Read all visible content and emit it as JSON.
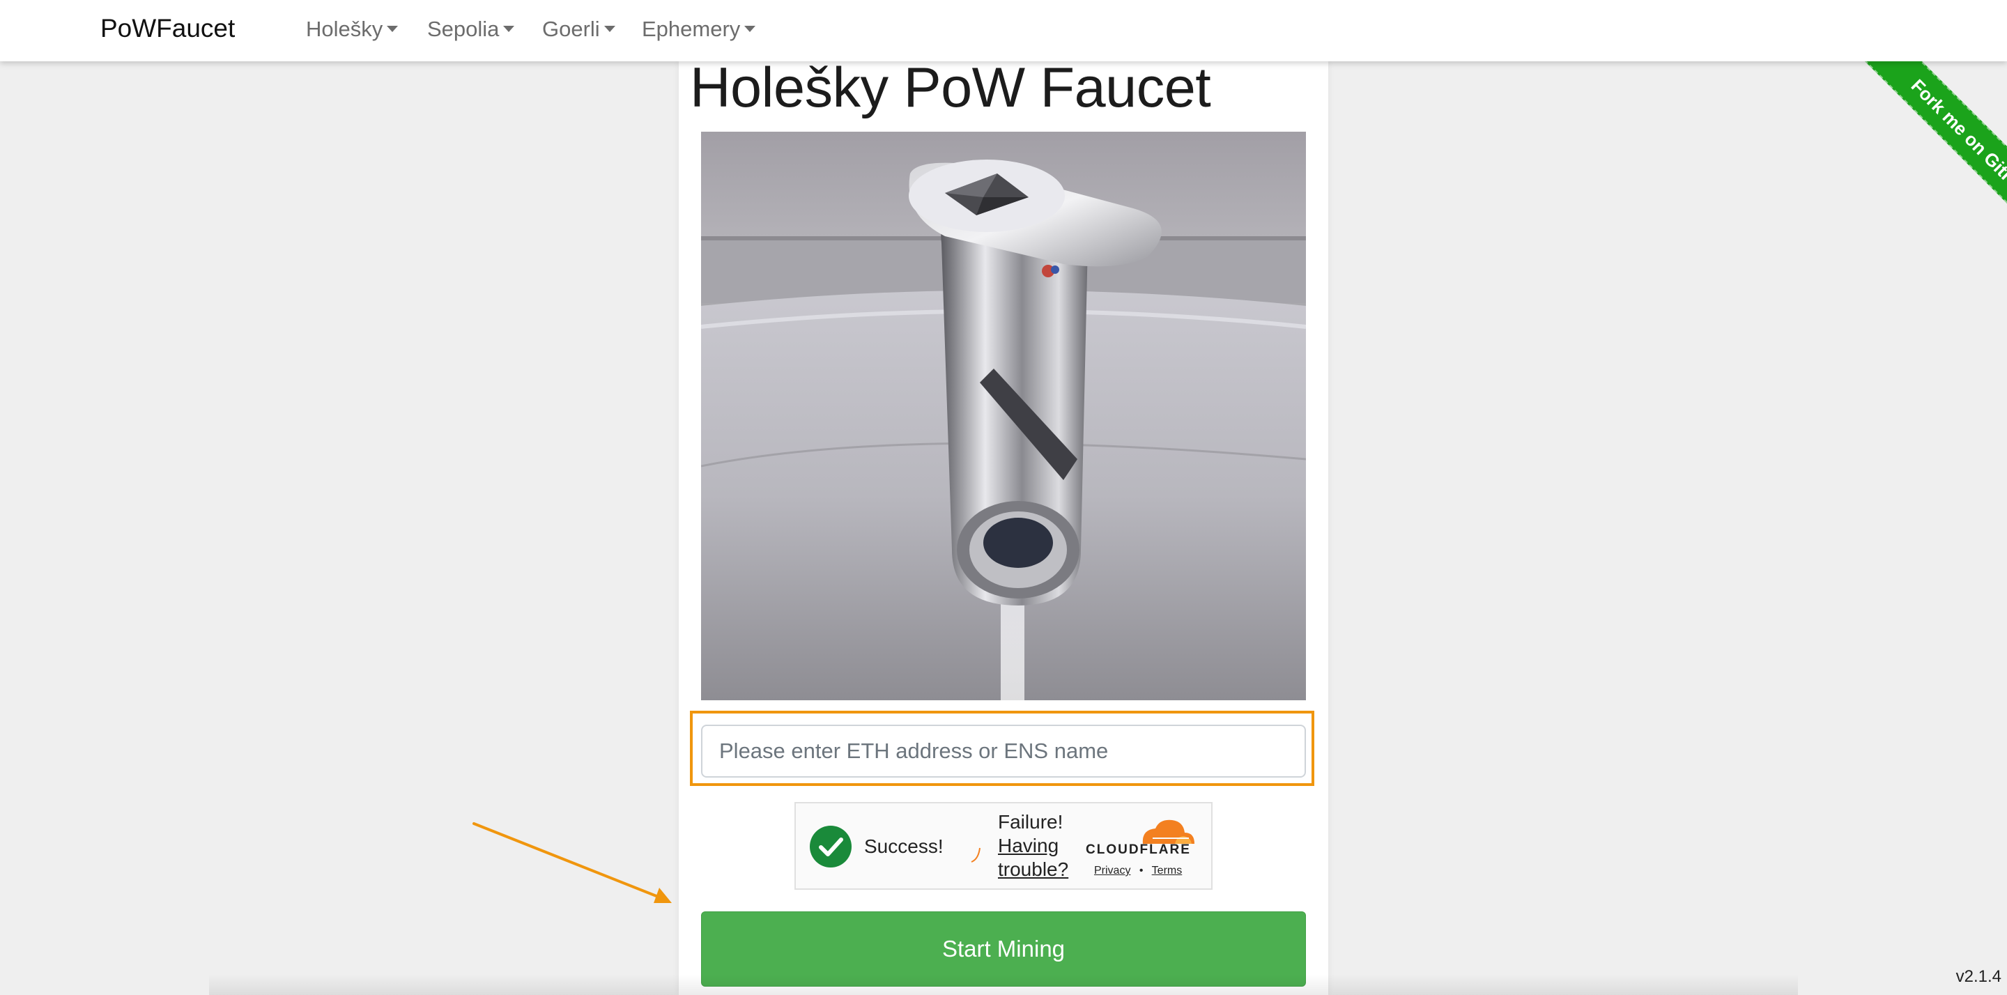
{
  "navbar": {
    "brand": "PoWFaucet",
    "items": [
      {
        "label": "Holešky"
      },
      {
        "label": "Sepolia"
      },
      {
        "label": "Goerli"
      },
      {
        "label": "Ephemery"
      }
    ]
  },
  "main": {
    "title": "Holešky PoW Faucet",
    "address_input": {
      "value": "",
      "placeholder": "Please enter ETH address or ENS name"
    },
    "captcha": {
      "success_text": "Success!",
      "failure_text": "Failure!",
      "trouble_link_line1": "Having",
      "trouble_link_line2": "trouble?",
      "provider": "CLOUDFLARE",
      "privacy_link": "Privacy",
      "separator": "•",
      "terms_link": "Terms"
    },
    "start_button": "Start Mining"
  },
  "ribbon": {
    "label": "Fork me on GitHub"
  },
  "footer": {
    "version": "v2.1.4"
  },
  "colors": {
    "accent_orange": "#f0960e",
    "button_green": "#4caf50",
    "ribbon_green": "#1ba31b",
    "captcha_check_green": "#1a8a3a",
    "cloudflare_orange": "#f38020"
  },
  "icons": [
    "caret-down-icon",
    "eth-faucet-photo",
    "checkmark-icon",
    "spinner-icon",
    "cloudflare-logo-icon",
    "arrow-annotation-icon"
  ]
}
